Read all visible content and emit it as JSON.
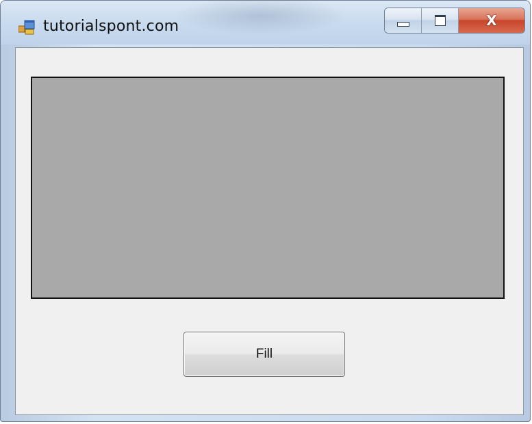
{
  "window": {
    "title": "tutorialspont.com",
    "icon": "windows-form-icon",
    "caption_buttons": {
      "minimize_icon": "minimize-icon",
      "maximize_icon": "maximize-icon",
      "close_glyph": "X"
    }
  },
  "form": {
    "panel": {
      "fill_color": "#a9a9a9",
      "border_color": "#111111"
    },
    "fill_button": {
      "label": "Fill"
    }
  }
}
